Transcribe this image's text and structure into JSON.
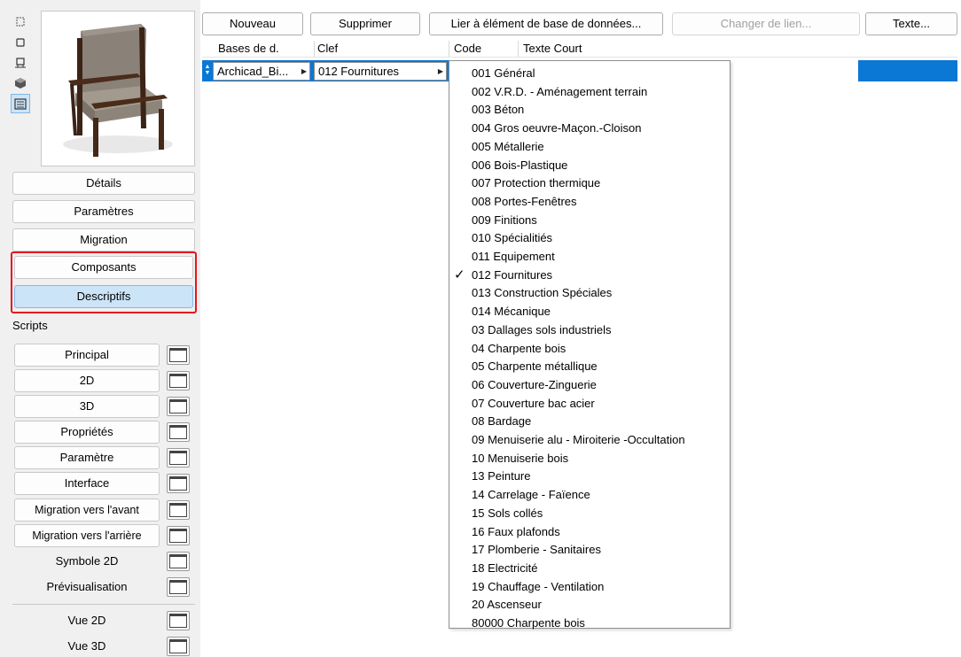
{
  "toolbar": {
    "new_label": "Nouveau",
    "delete_label": "Supprimer",
    "link_label": "Lier à élément de base de données...",
    "change_link_label": "Changer de lien...",
    "text_label": "Texte..."
  },
  "table": {
    "columns": [
      "Bases de d.",
      "Clef",
      "Code",
      "Texte Court"
    ],
    "row": {
      "database": "Archicad_Bi...",
      "key": "012  Fournitures"
    }
  },
  "dropdown": {
    "selected_index": 11,
    "items": [
      "001  Général",
      "002  V.R.D. - Aménagement terrain",
      "003  Béton",
      "004  Gros oeuvre-Maçon.-Cloison",
      "005  Métallerie",
      "006  Bois-Plastique",
      "007  Protection thermique",
      "008  Portes-Fenêtres",
      "009  Finitions",
      "010  Spécialitiés",
      "011  Equipement",
      "012  Fournitures",
      "013  Construction Spéciales",
      "014  Mécanique",
      "03  Dallages sols industriels",
      "04  Charpente bois",
      "05  Charpente métallique",
      "06  Couverture-Zinguerie",
      "07  Couverture bac acier",
      "08  Bardage",
      "09  Menuiserie alu - Miroiterie -Occultation",
      "10  Menuiserie bois",
      "13  Peinture",
      "14  Carrelage - Faïence",
      "15  Sols collés",
      "16  Faux plafonds",
      "17  Plomberie - Sanitaires",
      "18  Electricité",
      "19  Chauffage - Ventilation",
      "20  Ascenseur",
      "80000  Charpente bois"
    ]
  },
  "sidebar": {
    "details": "Détails",
    "parameters": "Paramètres",
    "migration": "Migration",
    "components": "Composants",
    "descriptors": "Descriptifs",
    "scripts_label": "Scripts",
    "scripts": [
      "Principal",
      "2D",
      "3D",
      "Propriétés",
      "Paramètre",
      "Interface",
      "Migration vers l'avant",
      "Migration vers l'arrière",
      "Symbole 2D",
      "Prévisualisation",
      "Vue 2D",
      "Vue 3D"
    ]
  },
  "colors": {
    "highlight_row": "#0a78d4",
    "selected_button": "#cce4f7",
    "annotation_box": "#e8151d"
  },
  "icons": [
    "floor-plan-view-icon",
    "section-view-icon",
    "elevation-view-icon",
    "3d-view-icon",
    "list-view-icon",
    "checkmark-icon",
    "window-icon"
  ]
}
